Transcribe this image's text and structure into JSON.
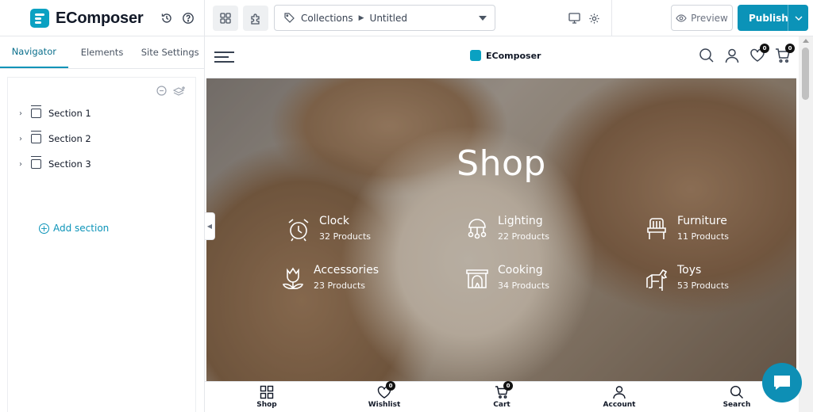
{
  "app": {
    "brand": "EComposer"
  },
  "toolbar": {
    "breadcrumb": {
      "parent": "Collections",
      "current": "Untitled"
    },
    "preview_label": "Preview",
    "publish_label": "Publish"
  },
  "sidebar": {
    "tabs": [
      "Navigator",
      "Elements",
      "Site Settings"
    ],
    "sections": [
      "Section 1",
      "Section 2",
      "Section 3"
    ],
    "add_section_label": "Add section"
  },
  "store": {
    "logo_text": "EComposer",
    "wishlist_count": "0",
    "cart_count": "0",
    "hero": {
      "title": "Shop",
      "categories": [
        {
          "name": "Clock",
          "count": "32 Products",
          "icon": "clock-icon"
        },
        {
          "name": "Lighting",
          "count": "22 Products",
          "icon": "lighting-icon"
        },
        {
          "name": "Furniture",
          "count": "11 Products",
          "icon": "chair-icon"
        },
        {
          "name": "Accessories",
          "count": "23 Products",
          "icon": "flower-icon"
        },
        {
          "name": "Cooking",
          "count": "34 Products",
          "icon": "fireplace-icon"
        },
        {
          "name": "Toys",
          "count": "53 Products",
          "icon": "toy-horse-icon"
        }
      ]
    },
    "bottom_nav": [
      {
        "label": "Shop",
        "icon": "grid-icon"
      },
      {
        "label": "Wishlist",
        "icon": "heart-icon",
        "badge": "0"
      },
      {
        "label": "Cart",
        "icon": "cart-icon",
        "badge": "0"
      },
      {
        "label": "Account",
        "icon": "user-icon"
      },
      {
        "label": "Search",
        "icon": "search-icon"
      }
    ]
  },
  "colors": {
    "accent": "#0b93b8",
    "brand": "#0aa1c2"
  }
}
